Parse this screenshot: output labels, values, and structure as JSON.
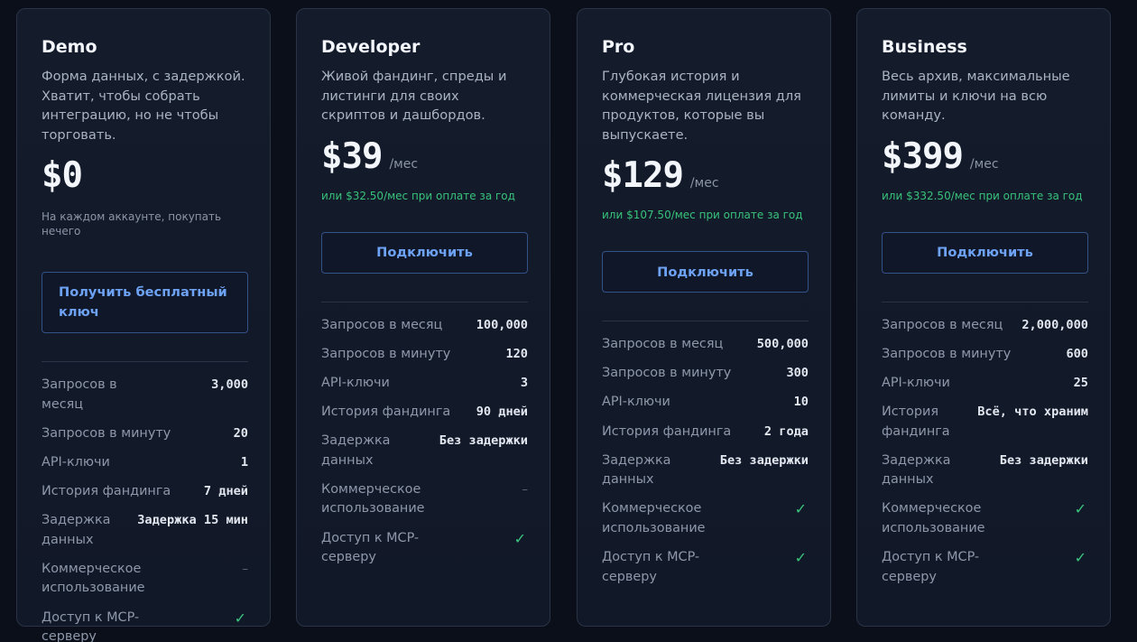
{
  "plans": [
    {
      "name": "Demo",
      "description": "Форма данных, с задержкой. Хватит, чтобы собрать интеграцию, но не чтобы торговать.",
      "price": "$0",
      "period": "",
      "note": "На каждом аккаунте, покупать нечего",
      "cta": "Получить бесплатный ключ",
      "features": [
        {
          "label": "Запросов в месяц",
          "value": "3,000"
        },
        {
          "label": "Запросов в минуту",
          "value": "20"
        },
        {
          "label": "API-ключи",
          "value": "1"
        },
        {
          "label": "История фандинга",
          "value": "7 дней"
        },
        {
          "label": "Задержка данных",
          "value": "Задержка 15 мин"
        },
        {
          "label": "Коммерческое использование",
          "value": "–"
        },
        {
          "label": "Доступ к MCP-серверу",
          "value": "✓"
        }
      ]
    },
    {
      "name": "Developer",
      "description": "Живой фандинг, спреды и листинги для своих скриптов и дашбордов.",
      "price": "$39",
      "period": "/мес",
      "note": "или $32.50/мес при оплате за год",
      "cta": "Подключить",
      "features": [
        {
          "label": "Запросов в месяц",
          "value": "100,000"
        },
        {
          "label": "Запросов в минуту",
          "value": "120"
        },
        {
          "label": "API-ключи",
          "value": "3"
        },
        {
          "label": "История фандинга",
          "value": "90 дней"
        },
        {
          "label": "Задержка данных",
          "value": "Без задержки"
        },
        {
          "label": "Коммерческое использование",
          "value": "–"
        },
        {
          "label": "Доступ к MCP-серверу",
          "value": "✓"
        }
      ]
    },
    {
      "name": "Pro",
      "description": "Глубокая история и коммерческая лицензия для продуктов, которые вы выпускаете.",
      "price": "$129",
      "period": "/мес",
      "note": "или $107.50/мес при оплате за год",
      "cta": "Подключить",
      "features": [
        {
          "label": "Запросов в месяц",
          "value": "500,000"
        },
        {
          "label": "Запросов в минуту",
          "value": "300"
        },
        {
          "label": "API-ключи",
          "value": "10"
        },
        {
          "label": "История фандинга",
          "value": "2 года"
        },
        {
          "label": "Задержка данных",
          "value": "Без задержки"
        },
        {
          "label": "Коммерческое использование",
          "value": "✓"
        },
        {
          "label": "Доступ к MCP-серверу",
          "value": "✓"
        }
      ]
    },
    {
      "name": "Business",
      "description": "Весь архив, максимальные лимиты и ключи на всю команду.",
      "price": "$399",
      "period": "/мес",
      "note": "или $332.50/мес при оплате за год",
      "cta": "Подключить",
      "features": [
        {
          "label": "Запросов в месяц",
          "value": "2,000,000"
        },
        {
          "label": "Запросов в минуту",
          "value": "600"
        },
        {
          "label": "API-ключи",
          "value": "25"
        },
        {
          "label": "История фандинга",
          "value": "Всё, что храним"
        },
        {
          "label": "Задержка данных",
          "value": "Без задержки"
        },
        {
          "label": "Коммерческое использование",
          "value": "✓"
        },
        {
          "label": "Доступ к MCP-серверу",
          "value": "✓"
        }
      ]
    }
  ],
  "colors": {
    "background": "#0a0f1a",
    "card": "#141c2c",
    "accent": "#6ea2f4",
    "success": "#38c27a"
  }
}
